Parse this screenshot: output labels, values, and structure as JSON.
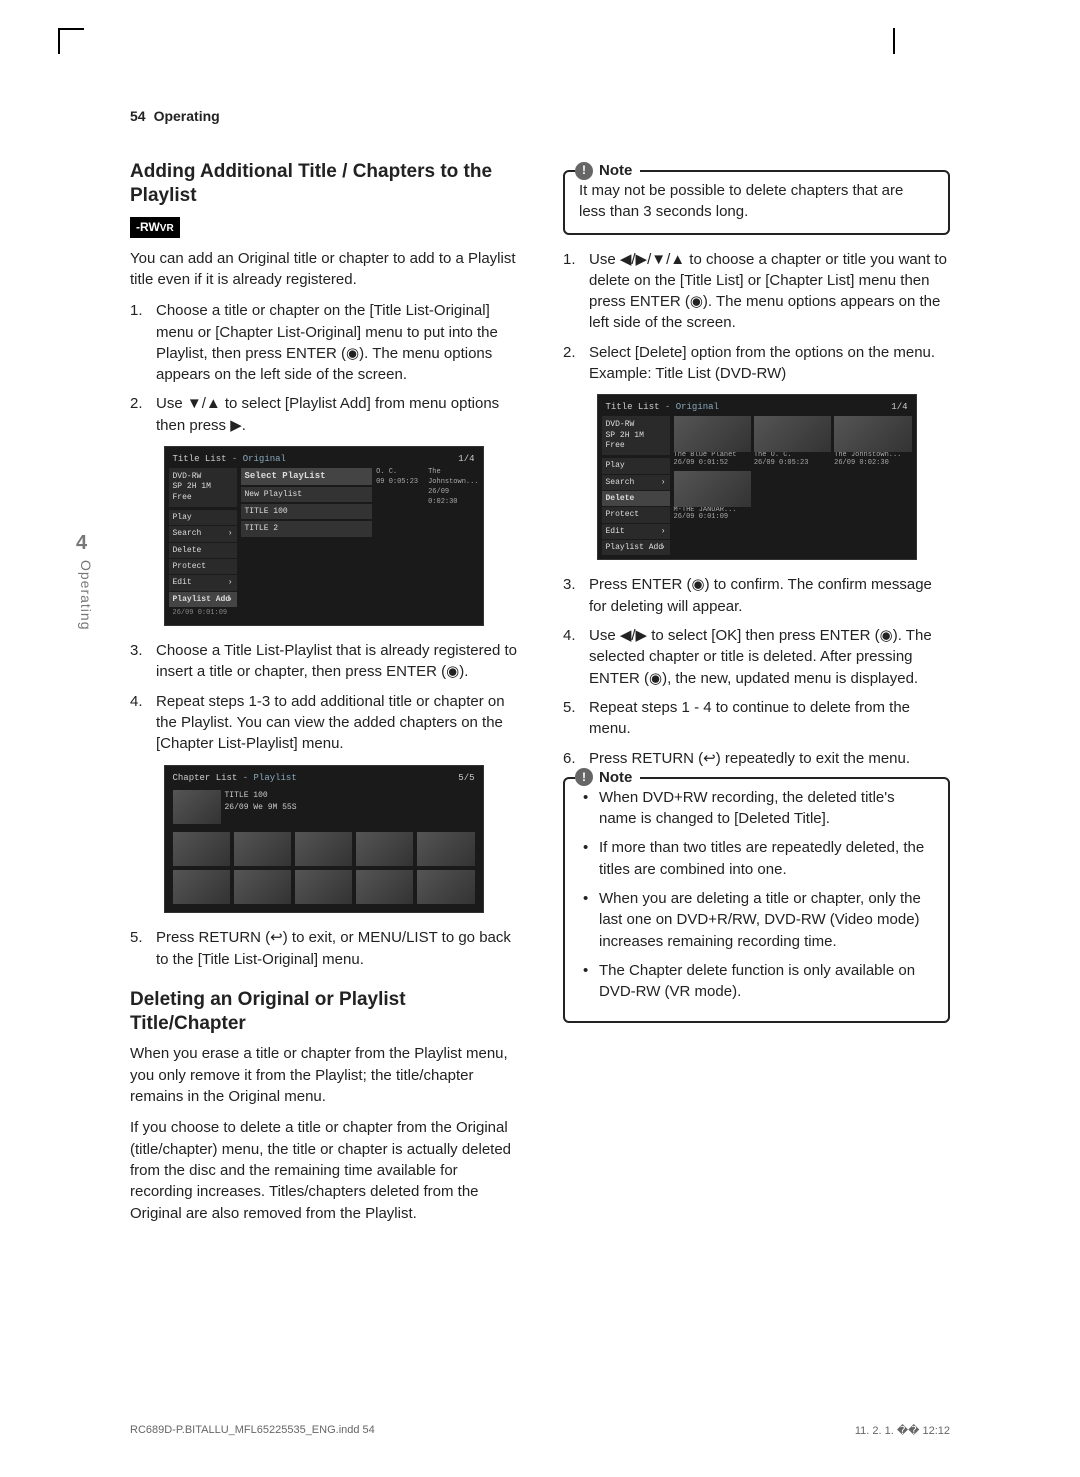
{
  "header": {
    "page_number": "54",
    "section": "Operating"
  },
  "side_tab": {
    "number": "4",
    "label": "Operating"
  },
  "left": {
    "heading1": "Adding Additional Title / Chapters to the Playlist",
    "badge": "-RWVR",
    "intro": "You can add an Original title or chapter to add to a Playlist title even if it is already registered.",
    "steps1": [
      "Choose a title or chapter on the [Title List-Original] menu or [Chapter List-Original] menu to put into the Playlist, then press ENTER (◉). The menu options appears on the left side of the screen.",
      "Use ▼/▲ to select [Playlist Add] from menu options then press ▶."
    ],
    "steps2": [
      "Choose a Title List-Playlist that is already registered to insert a title or chapter, then press ENTER (◉).",
      "Repeat steps 1-3 to add additional title or chapter on the Playlist. You can view the added chapters on the [Chapter List-Playlist] menu."
    ],
    "step5": "Press RETURN (↩) to exit, or MENU/LIST to go back to the [Title List-Original] menu.",
    "heading2": "Deleting an Original or Playlist Title/Chapter",
    "para1": "When you erase a title or chapter from the Playlist menu, you only remove it from the Playlist; the title/chapter remains in the Original menu.",
    "para2": "If you choose to delete a title or chapter from the Original (title/chapter) menu, the title or chapter is actually deleted from the disc and the remaining time available for recording increases. Titles/chapters deleted from the Original are also removed from the Playlist."
  },
  "right": {
    "note1": {
      "label": "Note",
      "text": "It may not be possible to delete chapters that are less than 3 seconds long."
    },
    "steps1": [
      "Use ◀/▶/▼/▲ to choose a chapter or title you want to delete on the [Title List] or [Chapter List] menu then press ENTER (◉). The menu options appears on the left side of the screen.",
      "Select [Delete] option from the options on the menu. Example: Title List (DVD-RW)"
    ],
    "steps2": [
      "Press ENTER (◉) to confirm. The confirm message for deleting will appear.",
      "Use ◀/▶ to select [OK] then press ENTER (◉). The selected chapter or title is deleted. After pressing ENTER (◉), the new, updated menu is displayed.",
      "Repeat steps 1 - 4 to continue to delete from the menu.",
      "Press RETURN (↩) repeatedly to exit the menu."
    ],
    "note2": {
      "label": "Note",
      "bullets": [
        "When DVD+RW recording, the deleted title's name is changed to [Deleted Title].",
        "If more than two titles are repeatedly deleted, the titles are combined into one.",
        "When you are deleting a title or chapter, only the last one on DVD+R/RW, DVD-RW (Video mode) increases remaining recording time.",
        "The Chapter delete function is only available on DVD-RW (VR mode)."
      ]
    }
  },
  "osd1": {
    "title": "Title List",
    "mode": "- Original",
    "page": "1/4",
    "info": {
      "disc": "DVD-RW",
      "rec": "SP 2H 1M",
      "free": "Free"
    },
    "menu": [
      "Play",
      "Search",
      "Delete",
      "Protect",
      "Edit",
      "Playlist Add"
    ],
    "popup": {
      "head": "Select PlayList",
      "items": [
        "New Playlist",
        "TITLE 100",
        "TITLE 2"
      ]
    },
    "thumbs": [
      {
        "cap1": "O. C.",
        "cap2": "09   0:05:23"
      },
      {
        "cap1": "The Johnstown...",
        "cap2": "26/09   0:02:30"
      }
    ],
    "foot": "26/09   0:01:09"
  },
  "osd2": {
    "title": "Chapter List",
    "mode": "- Playlist",
    "page": "5/5",
    "meta": "TITLE 100\n26/09 We   9M 55S"
  },
  "osd3": {
    "title": "Title List",
    "mode": "- Original",
    "page": "1/4",
    "info": {
      "disc": "DVD-RW",
      "rec": "SP 2H 1M",
      "free": "Free"
    },
    "menu": [
      "Play",
      "Search",
      "Delete",
      "Protect",
      "Edit",
      "Playlist Add"
    ],
    "thumbs": [
      {
        "cap1": "The Blue Planet",
        "cap2": "26/09   0:01:52"
      },
      {
        "cap1": "The O. C.",
        "cap2": "26/09   0:05:23"
      },
      {
        "cap1": "The Johnstown...",
        "cap2": "26/09   0:02:30"
      },
      {
        "cap1": "M-THE JANUAR...",
        "cap2": "26/09   0:01:09"
      }
    ]
  },
  "footer": {
    "left": "RC689D-P.BITALLU_MFL65225535_ENG.indd   54",
    "right": "11. 2. 1.   �� 12:12"
  }
}
